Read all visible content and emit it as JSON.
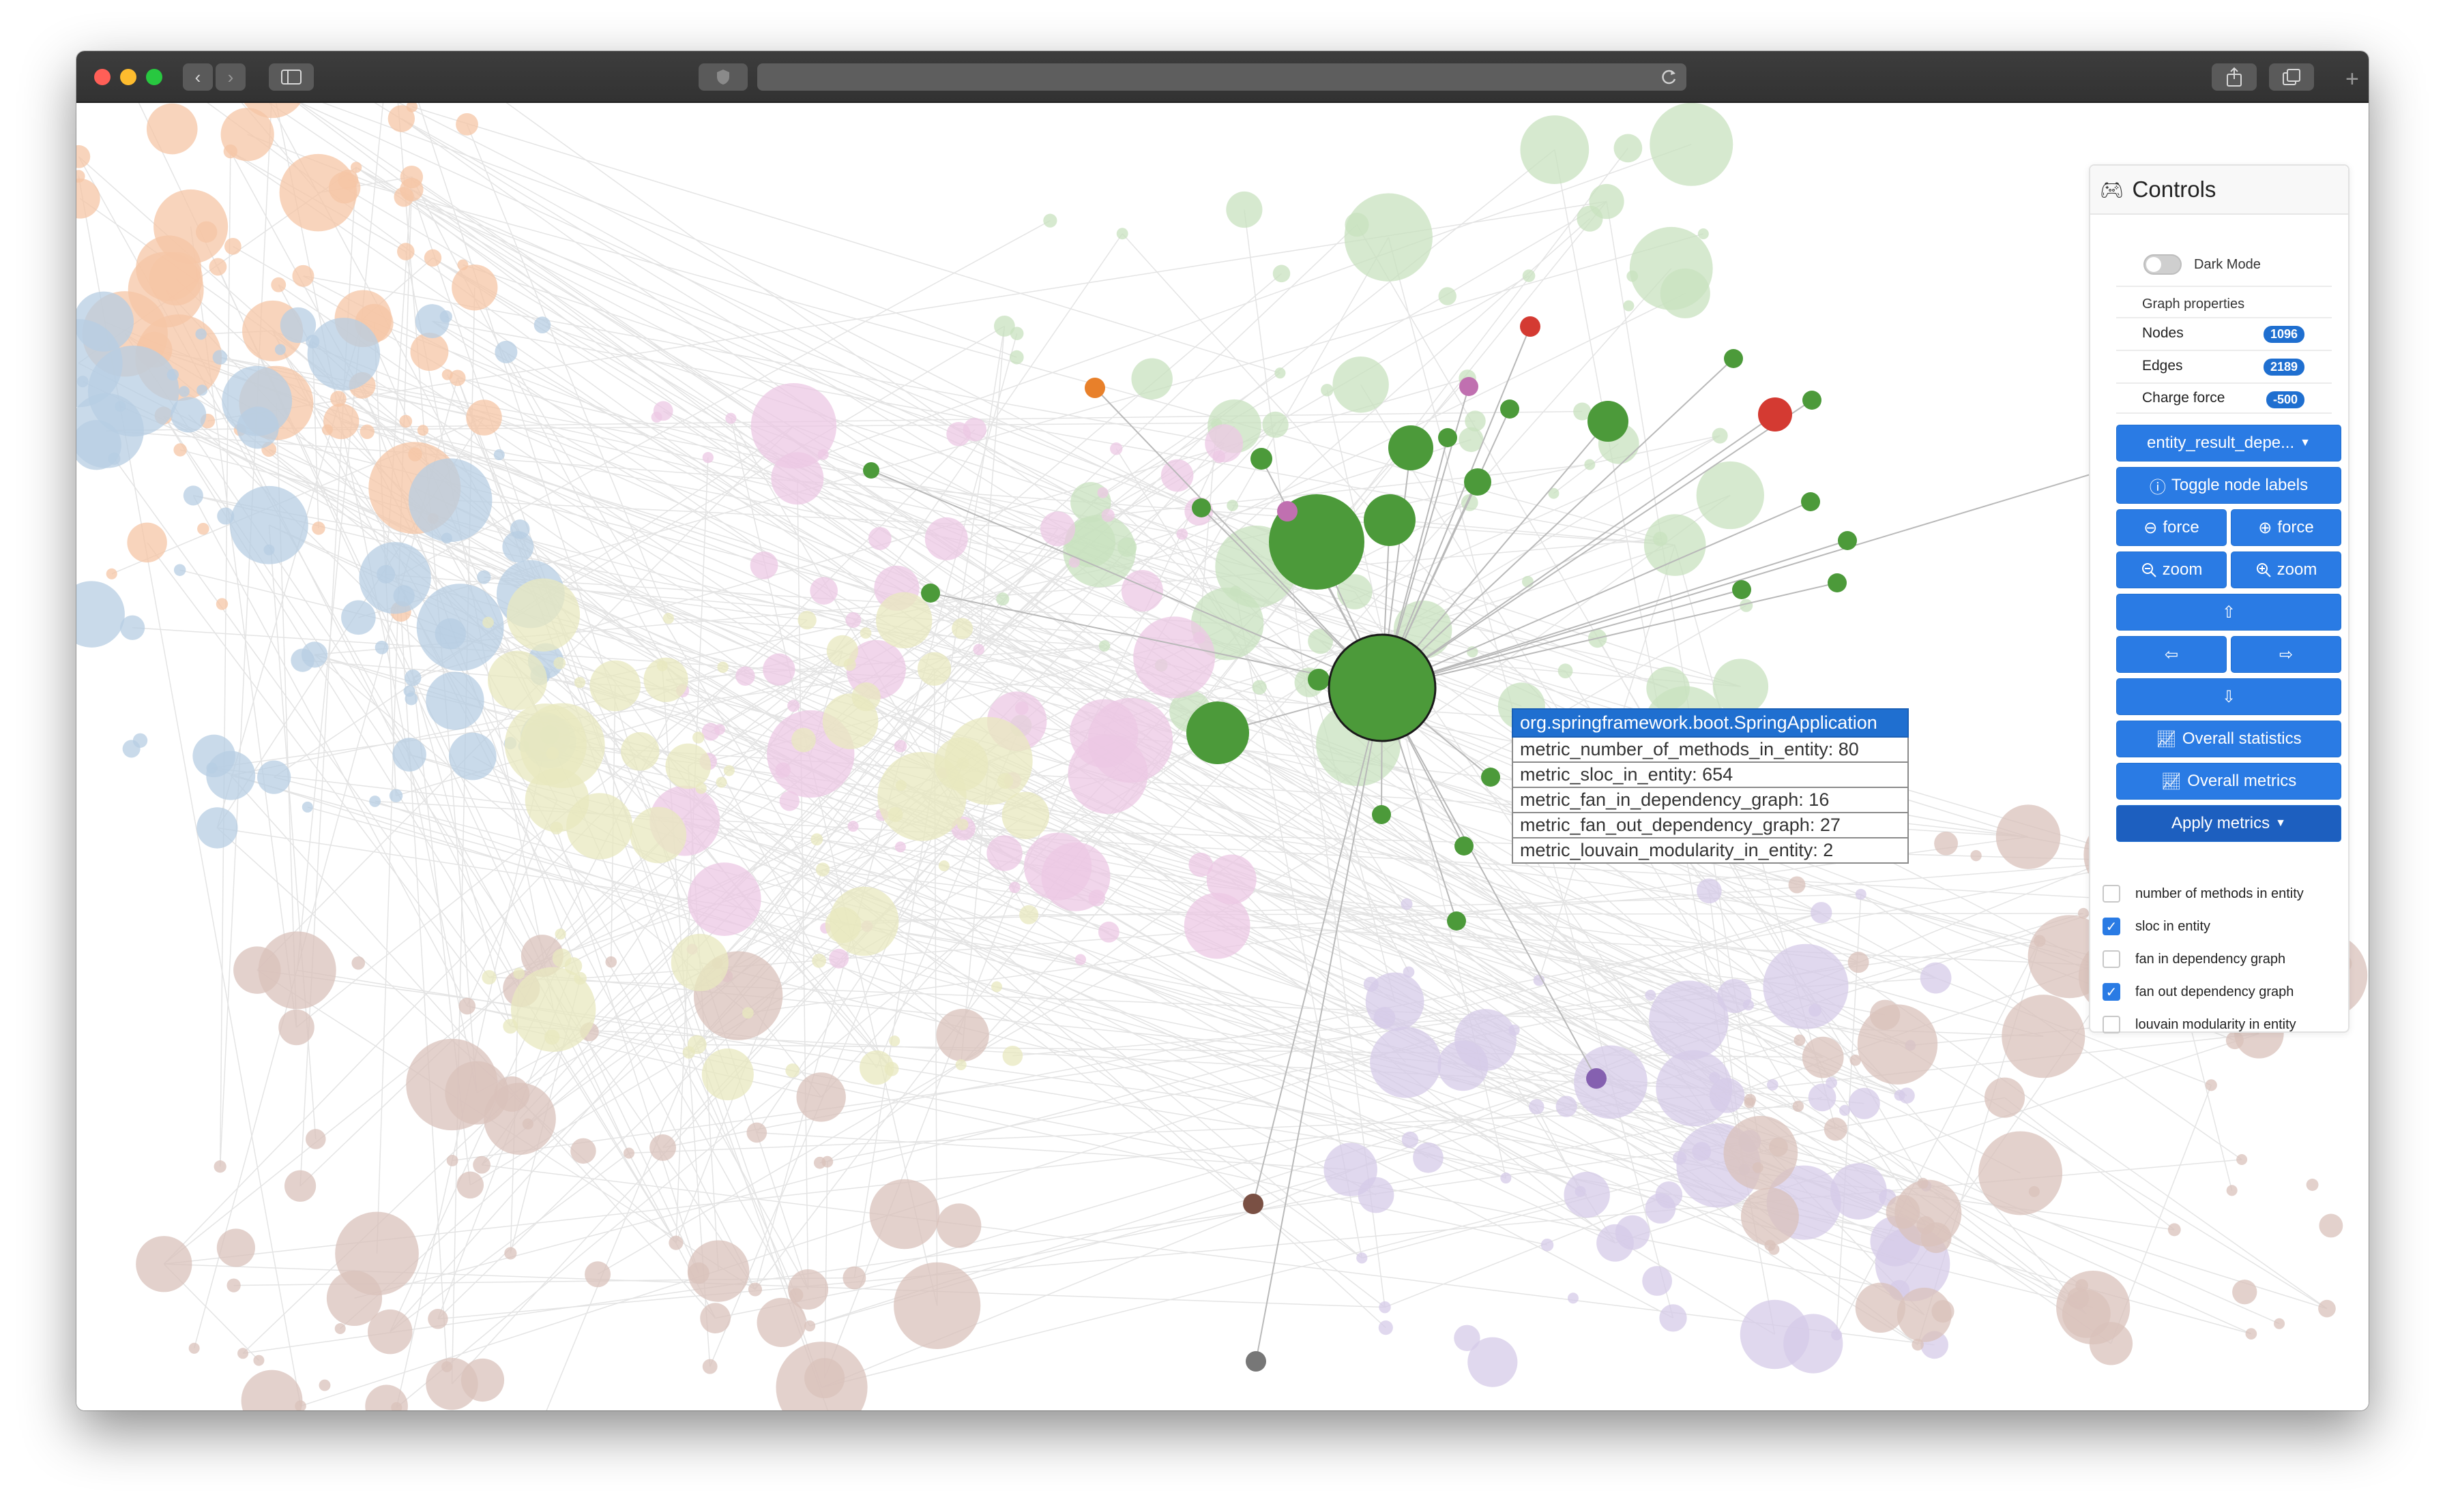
{
  "browser": {
    "back_icon": "chevron-left-icon",
    "forward_icon": "chevron-right-icon",
    "sidebar_icon": "sidebar-icon",
    "shield_icon": "shield-icon",
    "reload_icon": "reload-icon",
    "share_icon": "share-icon",
    "tabs_icon": "tabs-icon",
    "new_tab_icon": "plus-icon",
    "address": ""
  },
  "tooltip": {
    "title": "org.springframework.boot.SpringApplication",
    "rows": [
      "metric_number_of_methods_in_entity: 80",
      "metric_sloc_in_entity: 654",
      "metric_fan_in_dependency_graph: 16",
      "metric_fan_out_dependency_graph: 27",
      "metric_louvain_modularity_in_entity: 2"
    ]
  },
  "controls": {
    "title": "Controls",
    "title_icon": "gamepad-icon",
    "dark_mode_label": "Dark Mode",
    "dark_mode_on": false,
    "graph_properties_label": "Graph properties",
    "properties": [
      {
        "label": "Nodes",
        "value": "1096"
      },
      {
        "label": "Edges",
        "value": "2189"
      },
      {
        "label": "Charge force",
        "value": "-500"
      }
    ],
    "dataset_dropdown": "entity_result_depe...",
    "toggle_labels_button": "Toggle node labels",
    "force_decrease": "force",
    "force_increase": "force",
    "zoom_out": "zoom",
    "zoom_in": "zoom",
    "overall_statistics_button": "Overall statistics",
    "overall_metrics_button": "Overall metrics",
    "apply_metrics_button": "Apply metrics",
    "metrics": [
      {
        "label": "number of methods in entity",
        "checked": false
      },
      {
        "label": "sloc in entity",
        "checked": true
      },
      {
        "label": "fan in dependency graph",
        "checked": false
      },
      {
        "label": "fan out dependency graph",
        "checked": true
      },
      {
        "label": "louvain modularity in entity",
        "checked": false
      }
    ]
  },
  "colors": {
    "highlight_node": "#4c9a3a",
    "tooltip_title_bg": "#1f6fd0",
    "button_bg": "#2a7be4",
    "cluster_orange": "#f5c6a5",
    "cluster_blue": "#b7cde3",
    "cluster_green": "#c8e2bf",
    "cluster_pink": "#ecc8e4",
    "cluster_purple": "#d6cbe8",
    "cluster_brown": "#d9c2bb",
    "cluster_olive": "#e8e8bf"
  }
}
